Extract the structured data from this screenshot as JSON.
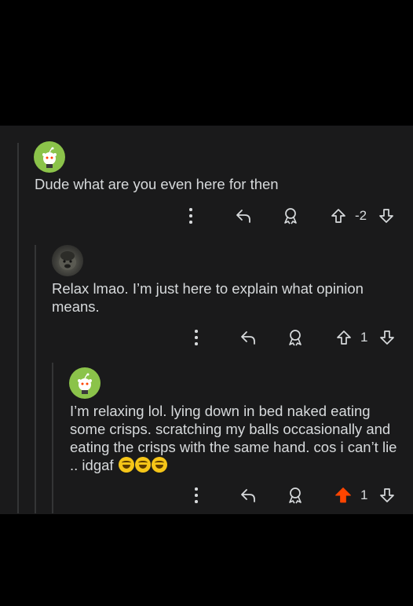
{
  "comments": [
    {
      "text": "Dude what are you even here for then",
      "score": "-2",
      "vote_state": "none"
    },
    {
      "text": "Relax lmao. I’m just here to explain what opinion means.",
      "score": "1",
      "vote_state": "none"
    },
    {
      "text": "I’m relaxing lol. lying down in bed naked eating some crisps. scratching my balls occasionally and eating the crisps with the same hand. cos i can’t lie .. idgaf",
      "emojis": [
        "laughing-tears-emoji",
        "laughing-tears-emoji",
        "laughing-tears-emoji"
      ],
      "score": "1",
      "vote_state": "upvoted"
    }
  ],
  "colors": {
    "background": "#000000",
    "panel": "#1a1a1b",
    "text": "#d7dadc",
    "thread_line": "#343536",
    "avatar_green": "#8bc34a",
    "upvote_active": "#ff4500"
  },
  "icons": [
    "more-options-icon",
    "reply-icon",
    "award-icon",
    "upvote-icon",
    "downvote-icon"
  ]
}
